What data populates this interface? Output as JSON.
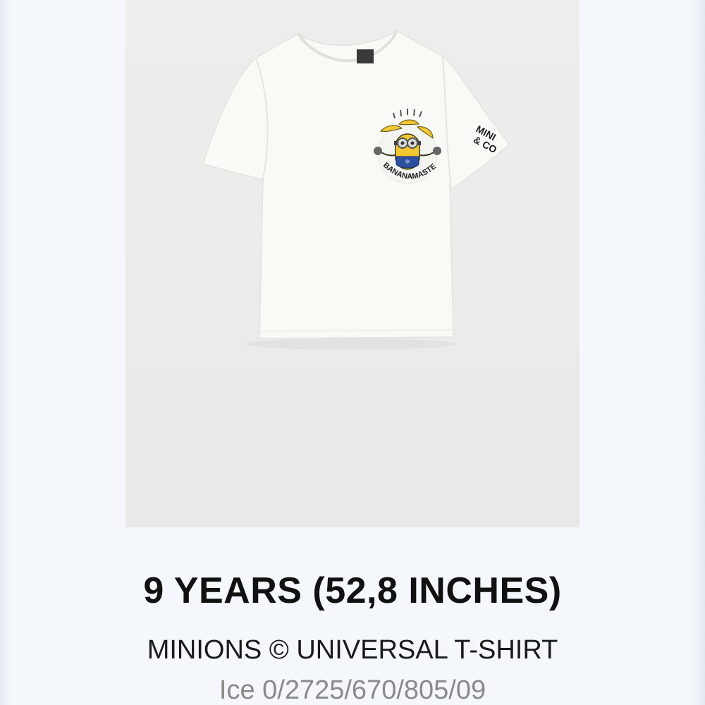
{
  "product": {
    "size_label": "9 YEARS (52,8 INCHES)",
    "name": "MINIONS © UNIVERSAL T-SHIRT",
    "reference": "Ice 0/2725/670/805/09",
    "image": {
      "print_text": "BANANAMASTE",
      "sleeve_text_line1": "MINI",
      "sleeve_text_line2": "& CO"
    }
  },
  "colors": {
    "background": "#f4f7fc",
    "image_background": "#ececec",
    "shirt": "#f9f9f6",
    "minion_yellow": "#f2c832",
    "overalls_blue": "#2d4fa0"
  }
}
